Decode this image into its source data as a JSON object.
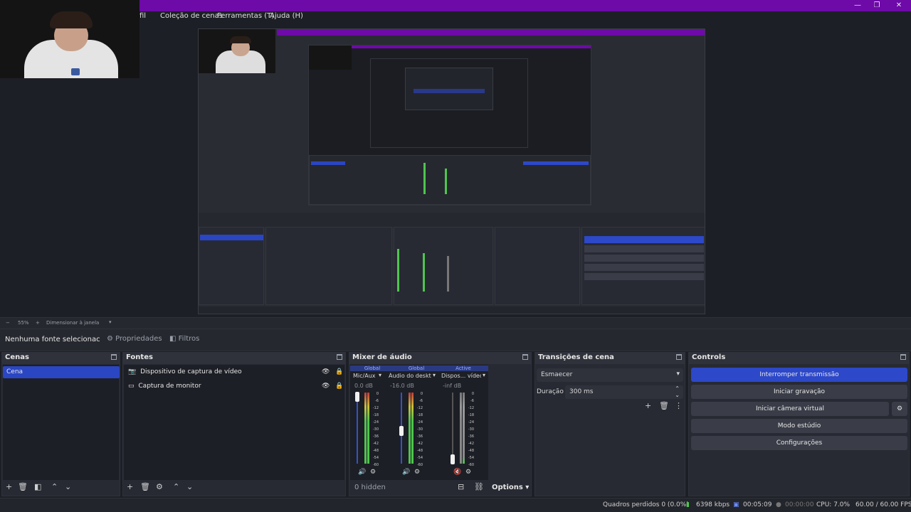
{
  "window": {
    "minimize": "—",
    "maximize": "❐",
    "close": "✕"
  },
  "menu": [
    "Perfil",
    "Coleção de cenas",
    "Ferramentas (T)",
    "Ajuda (H)"
  ],
  "zoombar": {
    "minus": "−",
    "zoom": "55%",
    "plus": "+",
    "mode": "Dimensionar à janela"
  },
  "toolbar": {
    "no_source": "Nenhuma fonte selecionac",
    "properties": "Propriedades",
    "filters": "Filtros"
  },
  "scenes": {
    "title": "Cenas",
    "items": [
      "Cena"
    ]
  },
  "sources": {
    "title": "Fontes",
    "items": [
      {
        "label": "Dispositivo de captura de vídeo",
        "icon": "camera-icon"
      },
      {
        "label": "Captura de monitor",
        "icon": "monitor-icon"
      }
    ]
  },
  "mixer": {
    "title": "Mixer de áudio",
    "channels": [
      {
        "tag": "Global",
        "name": "Mic/Aux",
        "db": "0.0 dB",
        "level": 0.0
      },
      {
        "tag": "Global",
        "name": "Áudio do desktop",
        "db": "-16.0 dB",
        "level": 0.55
      },
      {
        "tag": "Active",
        "name": "Dispos... vídeo",
        "db": "-inf dB",
        "level": 1.0
      }
    ],
    "ticks": [
      "0",
      "-6",
      "-12",
      "-18",
      "-24",
      "-30",
      "-36",
      "-42",
      "-48",
      "-54",
      "-60"
    ],
    "hidden": "0 hidden",
    "options": "Options"
  },
  "transitions": {
    "title": "Transições de cena",
    "type": "Esmaecer",
    "duration_label": "Duração",
    "duration": "300 ms"
  },
  "controls": {
    "title": "Controls",
    "buttons": [
      "Interromper transmissão",
      "Iniciar gravação",
      "Iniciar câmera virtual",
      "Modo estúdio",
      "Configurações"
    ]
  },
  "status": {
    "dropped": "Quadros perdidos 0 (0.0%)",
    "kbps": "6398 kbps",
    "stream_time": "00:05:09",
    "rec_time": "00:00:00",
    "cpu": "CPU: 7.0%",
    "fps": "60.00 / 60.00 FPS"
  },
  "colors": {
    "accent": "#2d48c8",
    "titlebar": "#6d0aa8",
    "meter_green": "#4fc44f",
    "meter_yellow": "#c9c23a",
    "meter_red": "#c23a3a"
  }
}
